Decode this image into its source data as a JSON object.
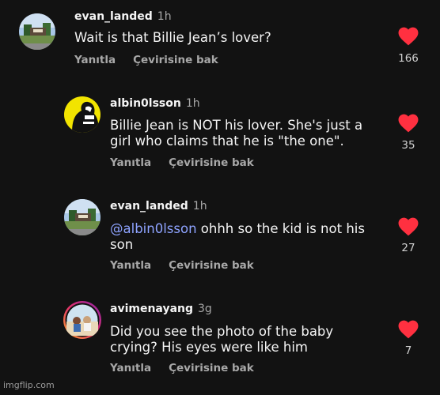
{
  "accent": "#ff3040",
  "mention_color": "#8ea3ff",
  "comments": [
    {
      "username": "evan_landed",
      "time": "1h",
      "text": "Wait is that Billie Jean’s lover?",
      "reply": "Yanıtla",
      "translate": "Çevirisine bak",
      "likes": "166",
      "avatar_icon": "landscape-photo-avatar"
    },
    {
      "username": "albin0lsson",
      "time": "1h",
      "text": "Billie Jean is NOT his lover. She's just a girl who claims that he is \"the one\".",
      "reply": "Yanıtla",
      "translate": "Çevirisine bak",
      "likes": "35",
      "avatar_icon": "silhouette-avatar"
    },
    {
      "username": "evan_landed",
      "time": "1h",
      "mention": "@albin0lsson",
      "text": " ohhh so the kid is not his son",
      "reply": "Yanıtla",
      "translate": "Çevirisine bak",
      "likes": "27",
      "avatar_icon": "landscape-photo-avatar"
    },
    {
      "username": "avimenayang",
      "time": "3g",
      "text": "Did you see the photo of the baby crying? His eyes were like him",
      "reply": "Yanıtla",
      "translate": "Çevirisine bak",
      "likes": "7",
      "avatar_icon": "story-ring-avatar"
    }
  ],
  "watermark": "imgflip.com"
}
